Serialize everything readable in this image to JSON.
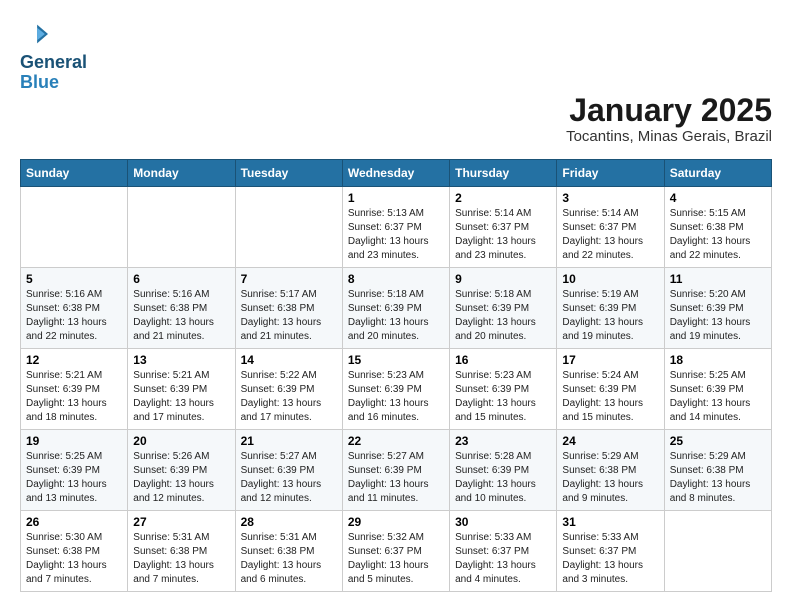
{
  "logo": {
    "text_general": "General",
    "text_blue": "Blue"
  },
  "header": {
    "title": "January 2025",
    "subtitle": "Tocantins, Minas Gerais, Brazil"
  },
  "days_of_week": [
    "Sunday",
    "Monday",
    "Tuesday",
    "Wednesday",
    "Thursday",
    "Friday",
    "Saturday"
  ],
  "weeks": [
    [
      {
        "day": "",
        "info": ""
      },
      {
        "day": "",
        "info": ""
      },
      {
        "day": "",
        "info": ""
      },
      {
        "day": "1",
        "info": "Sunrise: 5:13 AM\nSunset: 6:37 PM\nDaylight: 13 hours\nand 23 minutes."
      },
      {
        "day": "2",
        "info": "Sunrise: 5:14 AM\nSunset: 6:37 PM\nDaylight: 13 hours\nand 23 minutes."
      },
      {
        "day": "3",
        "info": "Sunrise: 5:14 AM\nSunset: 6:37 PM\nDaylight: 13 hours\nand 22 minutes."
      },
      {
        "day": "4",
        "info": "Sunrise: 5:15 AM\nSunset: 6:38 PM\nDaylight: 13 hours\nand 22 minutes."
      }
    ],
    [
      {
        "day": "5",
        "info": "Sunrise: 5:16 AM\nSunset: 6:38 PM\nDaylight: 13 hours\nand 22 minutes."
      },
      {
        "day": "6",
        "info": "Sunrise: 5:16 AM\nSunset: 6:38 PM\nDaylight: 13 hours\nand 21 minutes."
      },
      {
        "day": "7",
        "info": "Sunrise: 5:17 AM\nSunset: 6:38 PM\nDaylight: 13 hours\nand 21 minutes."
      },
      {
        "day": "8",
        "info": "Sunrise: 5:18 AM\nSunset: 6:39 PM\nDaylight: 13 hours\nand 20 minutes."
      },
      {
        "day": "9",
        "info": "Sunrise: 5:18 AM\nSunset: 6:39 PM\nDaylight: 13 hours\nand 20 minutes."
      },
      {
        "day": "10",
        "info": "Sunrise: 5:19 AM\nSunset: 6:39 PM\nDaylight: 13 hours\nand 19 minutes."
      },
      {
        "day": "11",
        "info": "Sunrise: 5:20 AM\nSunset: 6:39 PM\nDaylight: 13 hours\nand 19 minutes."
      }
    ],
    [
      {
        "day": "12",
        "info": "Sunrise: 5:21 AM\nSunset: 6:39 PM\nDaylight: 13 hours\nand 18 minutes."
      },
      {
        "day": "13",
        "info": "Sunrise: 5:21 AM\nSunset: 6:39 PM\nDaylight: 13 hours\nand 17 minutes."
      },
      {
        "day": "14",
        "info": "Sunrise: 5:22 AM\nSunset: 6:39 PM\nDaylight: 13 hours\nand 17 minutes."
      },
      {
        "day": "15",
        "info": "Sunrise: 5:23 AM\nSunset: 6:39 PM\nDaylight: 13 hours\nand 16 minutes."
      },
      {
        "day": "16",
        "info": "Sunrise: 5:23 AM\nSunset: 6:39 PM\nDaylight: 13 hours\nand 15 minutes."
      },
      {
        "day": "17",
        "info": "Sunrise: 5:24 AM\nSunset: 6:39 PM\nDaylight: 13 hours\nand 15 minutes."
      },
      {
        "day": "18",
        "info": "Sunrise: 5:25 AM\nSunset: 6:39 PM\nDaylight: 13 hours\nand 14 minutes."
      }
    ],
    [
      {
        "day": "19",
        "info": "Sunrise: 5:25 AM\nSunset: 6:39 PM\nDaylight: 13 hours\nand 13 minutes."
      },
      {
        "day": "20",
        "info": "Sunrise: 5:26 AM\nSunset: 6:39 PM\nDaylight: 13 hours\nand 12 minutes."
      },
      {
        "day": "21",
        "info": "Sunrise: 5:27 AM\nSunset: 6:39 PM\nDaylight: 13 hours\nand 12 minutes."
      },
      {
        "day": "22",
        "info": "Sunrise: 5:27 AM\nSunset: 6:39 PM\nDaylight: 13 hours\nand 11 minutes."
      },
      {
        "day": "23",
        "info": "Sunrise: 5:28 AM\nSunset: 6:39 PM\nDaylight: 13 hours\nand 10 minutes."
      },
      {
        "day": "24",
        "info": "Sunrise: 5:29 AM\nSunset: 6:38 PM\nDaylight: 13 hours\nand 9 minutes."
      },
      {
        "day": "25",
        "info": "Sunrise: 5:29 AM\nSunset: 6:38 PM\nDaylight: 13 hours\nand 8 minutes."
      }
    ],
    [
      {
        "day": "26",
        "info": "Sunrise: 5:30 AM\nSunset: 6:38 PM\nDaylight: 13 hours\nand 7 minutes."
      },
      {
        "day": "27",
        "info": "Sunrise: 5:31 AM\nSunset: 6:38 PM\nDaylight: 13 hours\nand 7 minutes."
      },
      {
        "day": "28",
        "info": "Sunrise: 5:31 AM\nSunset: 6:38 PM\nDaylight: 13 hours\nand 6 minutes."
      },
      {
        "day": "29",
        "info": "Sunrise: 5:32 AM\nSunset: 6:37 PM\nDaylight: 13 hours\nand 5 minutes."
      },
      {
        "day": "30",
        "info": "Sunrise: 5:33 AM\nSunset: 6:37 PM\nDaylight: 13 hours\nand 4 minutes."
      },
      {
        "day": "31",
        "info": "Sunrise: 5:33 AM\nSunset: 6:37 PM\nDaylight: 13 hours\nand 3 minutes."
      },
      {
        "day": "",
        "info": ""
      }
    ]
  ]
}
